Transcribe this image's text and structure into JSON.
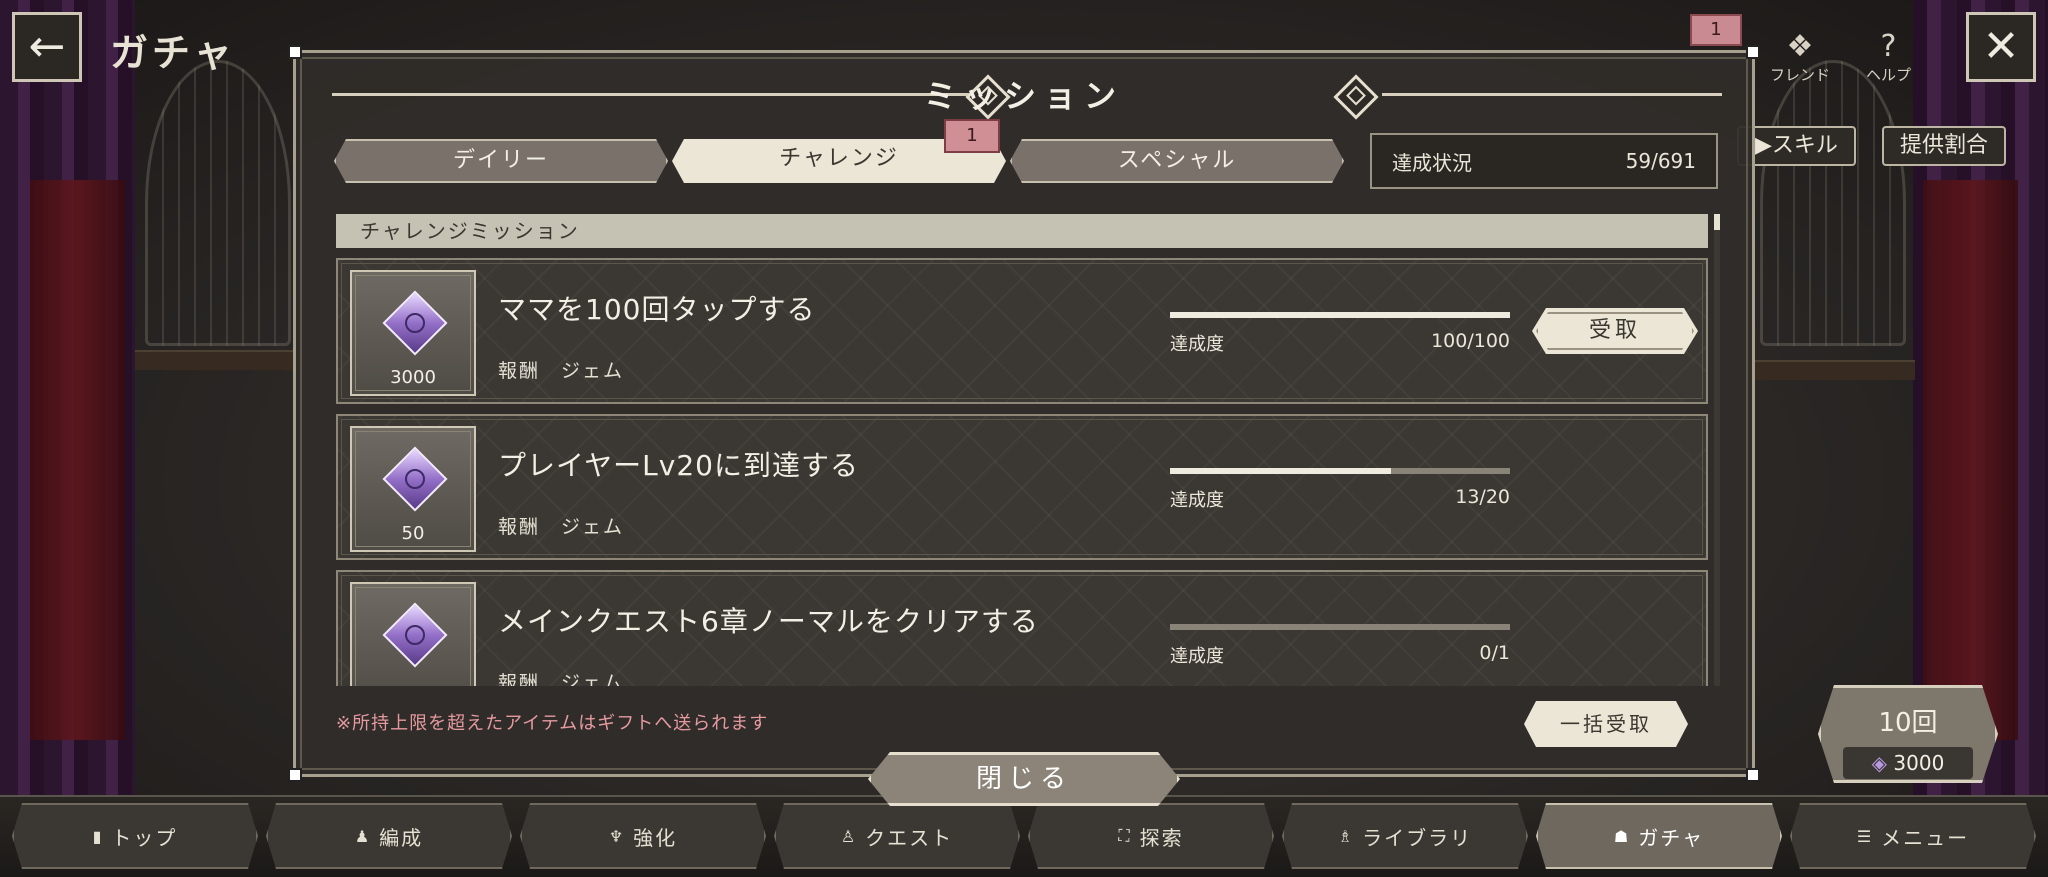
{
  "screen": {
    "title": "ガチャ"
  },
  "header": {
    "back_icon": "arrow-left-icon",
    "close_icon": "cross-icon",
    "notification_badge": "1",
    "menu_items": [
      {
        "icon": "friend-icon",
        "label": "フレンド"
      },
      {
        "icon": "help-icon",
        "label": "ヘルプ"
      }
    ]
  },
  "side_buttons": {
    "skill": "▶スキル",
    "rates": "提供割合"
  },
  "dialog": {
    "title": "ミッション",
    "tabs": [
      {
        "label": "デイリー",
        "active": false
      },
      {
        "label": "チャレンジ",
        "active": true,
        "badge": "1"
      },
      {
        "label": "スペシャル",
        "active": false
      }
    ],
    "status": {
      "label": "達成状況",
      "value": "59/691"
    },
    "section_header": "チャレンジミッション",
    "missions": [
      {
        "title": "ママを100回タップする",
        "reward_label": "報酬",
        "reward_item": "ジェム",
        "reward_qty": "3000",
        "progress_label": "達成度",
        "progress_value": "100/100",
        "progress_ratio": 1.0,
        "claim_label": "受取"
      },
      {
        "title": "プレイヤーLv20に到達する",
        "reward_label": "報酬",
        "reward_item": "ジェム",
        "reward_qty": "50",
        "progress_label": "達成度",
        "progress_value": "13/20",
        "progress_ratio": 0.65
      },
      {
        "title": "メインクエスト6章ノーマルをクリアする",
        "reward_label": "報酬",
        "reward_item": "ジェム",
        "reward_qty": "",
        "progress_label": "達成度",
        "progress_value": "0/1",
        "progress_ratio": 0.0
      }
    ],
    "notice": "※所持上限を超えたアイテムはギフトへ送られます",
    "bulk_claim_label": "一括受取",
    "close_label": "閉じる"
  },
  "gacha_pull": {
    "count_label": "10回",
    "cost": "3000",
    "cost_icon": "gem-icon"
  },
  "nav": [
    {
      "label": "トップ",
      "icon": "home-icon",
      "active": false
    },
    {
      "label": "編成",
      "icon": "party-icon",
      "active": false
    },
    {
      "label": "強化",
      "icon": "upgrade-icon",
      "active": false
    },
    {
      "label": "クエスト",
      "icon": "quest-icon",
      "active": false
    },
    {
      "label": "探索",
      "icon": "explore-icon",
      "active": false
    },
    {
      "label": "ライブラリ",
      "icon": "library-icon",
      "active": false
    },
    {
      "label": "ガチャ",
      "icon": "gacha-icon",
      "active": true
    },
    {
      "label": "メニュー",
      "icon": "menu-icon",
      "active": false
    }
  ],
  "colors": {
    "notice": "#e69aa0",
    "badge": "#d08e95",
    "gem": "#9470c8"
  }
}
